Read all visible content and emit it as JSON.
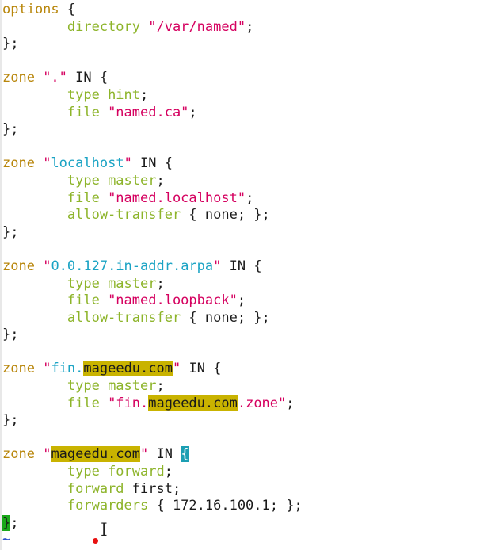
{
  "lines": [
    [
      {
        "t": "options",
        "c": "kw"
      },
      {
        "t": " {",
        "c": ""
      }
    ],
    [
      {
        "t": "        directory ",
        "c": "grn"
      },
      {
        "t": "\"/var/named\"",
        "c": "str"
      },
      {
        "t": ";",
        "c": ""
      }
    ],
    [
      {
        "t": "};",
        "c": ""
      }
    ],
    [],
    [
      {
        "t": "zone ",
        "c": "kw"
      },
      {
        "t": "\".\"",
        "c": "str"
      },
      {
        "t": " IN {",
        "c": ""
      }
    ],
    [
      {
        "t": "        type ",
        "c": "grn"
      },
      {
        "t": "hint",
        "c": "grn"
      },
      {
        "t": ";",
        "c": ""
      }
    ],
    [
      {
        "t": "        file ",
        "c": "grn"
      },
      {
        "t": "\"named.ca\"",
        "c": "str"
      },
      {
        "t": ";",
        "c": ""
      }
    ],
    [
      {
        "t": "};",
        "c": ""
      }
    ],
    [],
    [
      {
        "t": "zone ",
        "c": "kw"
      },
      {
        "t": "\"",
        "c": "str"
      },
      {
        "t": "localhost",
        "c": "cyn"
      },
      {
        "t": "\"",
        "c": "str"
      },
      {
        "t": " IN {",
        "c": ""
      }
    ],
    [
      {
        "t": "        type ",
        "c": "grn"
      },
      {
        "t": "master",
        "c": "grn"
      },
      {
        "t": ";",
        "c": ""
      }
    ],
    [
      {
        "t": "        file ",
        "c": "grn"
      },
      {
        "t": "\"named.localhost\"",
        "c": "str"
      },
      {
        "t": ";",
        "c": ""
      }
    ],
    [
      {
        "t": "        allow-transfer ",
        "c": "grn"
      },
      {
        "t": "{ none; };",
        "c": ""
      }
    ],
    [
      {
        "t": "};",
        "c": ""
      }
    ],
    [],
    [
      {
        "t": "zone ",
        "c": "kw"
      },
      {
        "t": "\"",
        "c": "str"
      },
      {
        "t": "0.0.127.in-addr.arpa",
        "c": "cyn"
      },
      {
        "t": "\"",
        "c": "str"
      },
      {
        "t": " IN {",
        "c": ""
      }
    ],
    [
      {
        "t": "        type ",
        "c": "grn"
      },
      {
        "t": "master",
        "c": "grn"
      },
      {
        "t": ";",
        "c": ""
      }
    ],
    [
      {
        "t": "        file ",
        "c": "grn"
      },
      {
        "t": "\"named.loopback\"",
        "c": "str"
      },
      {
        "t": ";",
        "c": ""
      }
    ],
    [
      {
        "t": "        allow-transfer ",
        "c": "grn"
      },
      {
        "t": "{ none; };",
        "c": ""
      }
    ],
    [
      {
        "t": "};",
        "c": ""
      }
    ],
    [],
    [
      {
        "t": "zone ",
        "c": "kw"
      },
      {
        "t": "\"",
        "c": "str"
      },
      {
        "t": "fin.",
        "c": "cyn"
      },
      {
        "t": "mageedu.com",
        "c": "hl"
      },
      {
        "t": "\"",
        "c": "str"
      },
      {
        "t": " IN {",
        "c": ""
      }
    ],
    [
      {
        "t": "        type ",
        "c": "grn"
      },
      {
        "t": "master",
        "c": "grn"
      },
      {
        "t": ";",
        "c": ""
      }
    ],
    [
      {
        "t": "        file ",
        "c": "grn"
      },
      {
        "t": "\"fin.",
        "c": "str"
      },
      {
        "t": "mageedu.com",
        "c": "hl"
      },
      {
        "t": ".zone\"",
        "c": "str"
      },
      {
        "t": ";",
        "c": ""
      }
    ],
    [
      {
        "t": "};",
        "c": ""
      }
    ],
    [],
    [
      {
        "t": "zone ",
        "c": "kw"
      },
      {
        "t": "\"",
        "c": "str"
      },
      {
        "t": "mageedu.com",
        "c": "hl"
      },
      {
        "t": "\"",
        "c": "str"
      },
      {
        "t": " IN ",
        "c": ""
      },
      {
        "t": "{",
        "c": "brace-hl"
      }
    ],
    [
      {
        "t": "        type ",
        "c": "grn"
      },
      {
        "t": "forward",
        "c": "grn"
      },
      {
        "t": ";",
        "c": ""
      }
    ],
    [
      {
        "t": "        forward ",
        "c": "grn"
      },
      {
        "t": "first;",
        "c": ""
      }
    ],
    [
      {
        "t": "        forwarders ",
        "c": "grn"
      },
      {
        "t": "{ 172.16.100.1; };",
        "c": ""
      }
    ],
    [
      {
        "t": "}",
        "c": "cursor"
      },
      {
        "t": ";",
        "c": ""
      }
    ],
    [
      {
        "t": "~",
        "c": "tilde"
      }
    ]
  ],
  "mouse_cursor": "I"
}
